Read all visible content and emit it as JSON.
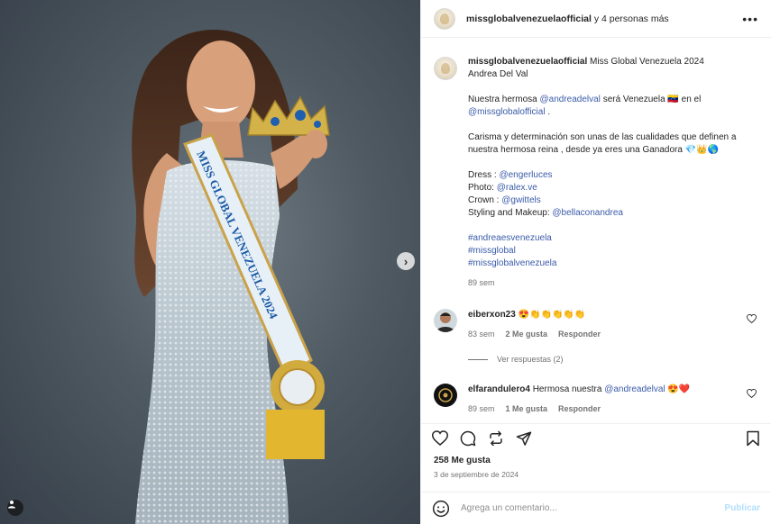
{
  "header": {
    "username": "missglobalvenezuelaofficial",
    "coauthors": "y 4 personas más"
  },
  "caption": {
    "username": "missglobalvenezuelaofficial",
    "title_line1": "Miss Global Venezuela 2024",
    "title_line2": "Andrea Del Val",
    "p2_prefix": "Nuestra hermosa",
    "p2_mention1": "@andreadelval",
    "p2_middle": "será Venezuela 🇻🇪 en el",
    "p2_mention2": "@missglobalofficial",
    "p2_suffix": ".",
    "p3": "Carisma y determinación son unas de las cualidades que definen a nuestra hermosa reina , desde ya eres una Ganadora 💎👑🌎",
    "credits": [
      {
        "label": "Dress :",
        "mention": "@engerluces"
      },
      {
        "label": "Photo:",
        "mention": "@ralex.ve"
      },
      {
        "label": "Crown :",
        "mention": "@gwittels"
      },
      {
        "label": "Styling and Makeup:",
        "mention": "@bellaconandrea"
      }
    ],
    "hashtags": [
      "#andreaesvenezuela",
      "#missglobal",
      "#missglobalvenezuela"
    ],
    "time": "89 sem"
  },
  "comments": [
    {
      "username": "eiberxon23",
      "text": "😍👏👏👏👏👏",
      "time": "83 sem",
      "likes": "2 Me gusta",
      "reply": "Responder",
      "view_replies": "Ver respuestas (2)"
    },
    {
      "username": "elfarandulero4",
      "text_prefix": "Hermosa nuestra",
      "mention": "@andreadelval",
      "text_suffix": "😍❤️",
      "time": "89 sem",
      "likes": "1 Me gusta",
      "reply": "Responder"
    }
  ],
  "stats": {
    "likes": "258 Me gusta",
    "date": "3 de septiembre de 2024"
  },
  "composer": {
    "placeholder": "Agrega un comentario...",
    "submit": "Publicar"
  },
  "photo": {
    "sash_text": "MISS GLOBAL VENEZUELA 2024",
    "icons": {
      "next": "chevron-right-icon",
      "tagged": "person-tag-icon"
    }
  },
  "colors": {
    "link": "#3a5ba8",
    "muted": "#737373",
    "publish_disabled": "#b2dffc",
    "heart": "#ed4956"
  }
}
